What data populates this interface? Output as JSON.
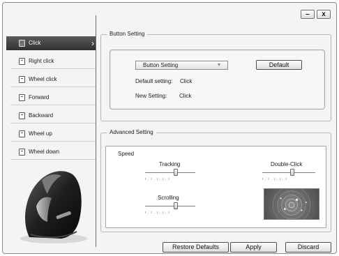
{
  "window": {
    "minimize_label": "–",
    "close_label": "x"
  },
  "sidebar": {
    "items": [
      {
        "label": "Click",
        "icon": "mouse-button-icon",
        "active": true
      },
      {
        "label": "Right click",
        "icon": "mouse-button-icon"
      },
      {
        "label": "Wheel click",
        "icon": "mouse-button-icon"
      },
      {
        "label": "Forward",
        "icon": "mouse-button-icon"
      },
      {
        "label": "Backward",
        "icon": "mouse-button-icon"
      },
      {
        "label": "Wheel up",
        "icon": "mouse-button-icon"
      },
      {
        "label": "Wheel down",
        "icon": "mouse-button-icon"
      }
    ],
    "active_chevron": "›"
  },
  "button_setting": {
    "title": "Button Setting",
    "select_value": "Button Setting",
    "default_button": "Default",
    "default_setting_label": "Default setting:",
    "default_setting_value": "Click",
    "new_setting_label": "New Setting:",
    "new_setting_value": "Click"
  },
  "advanced_setting": {
    "title": "Advanced Setting",
    "speed_label": "Speed",
    "tracking_label": "Tracking",
    "double_click_label": "Double-Click",
    "scrolling_label": "Scrolling",
    "tracking_level": 0.6,
    "double_click_level": 0.55,
    "scrolling_level": 0.6
  },
  "footer": {
    "restore_defaults": "Restore Defaults",
    "apply": "Apply",
    "discard": "Discard"
  },
  "colors": {
    "active_item": "#3a3a3a",
    "window_bg": "#f4f4f4"
  }
}
